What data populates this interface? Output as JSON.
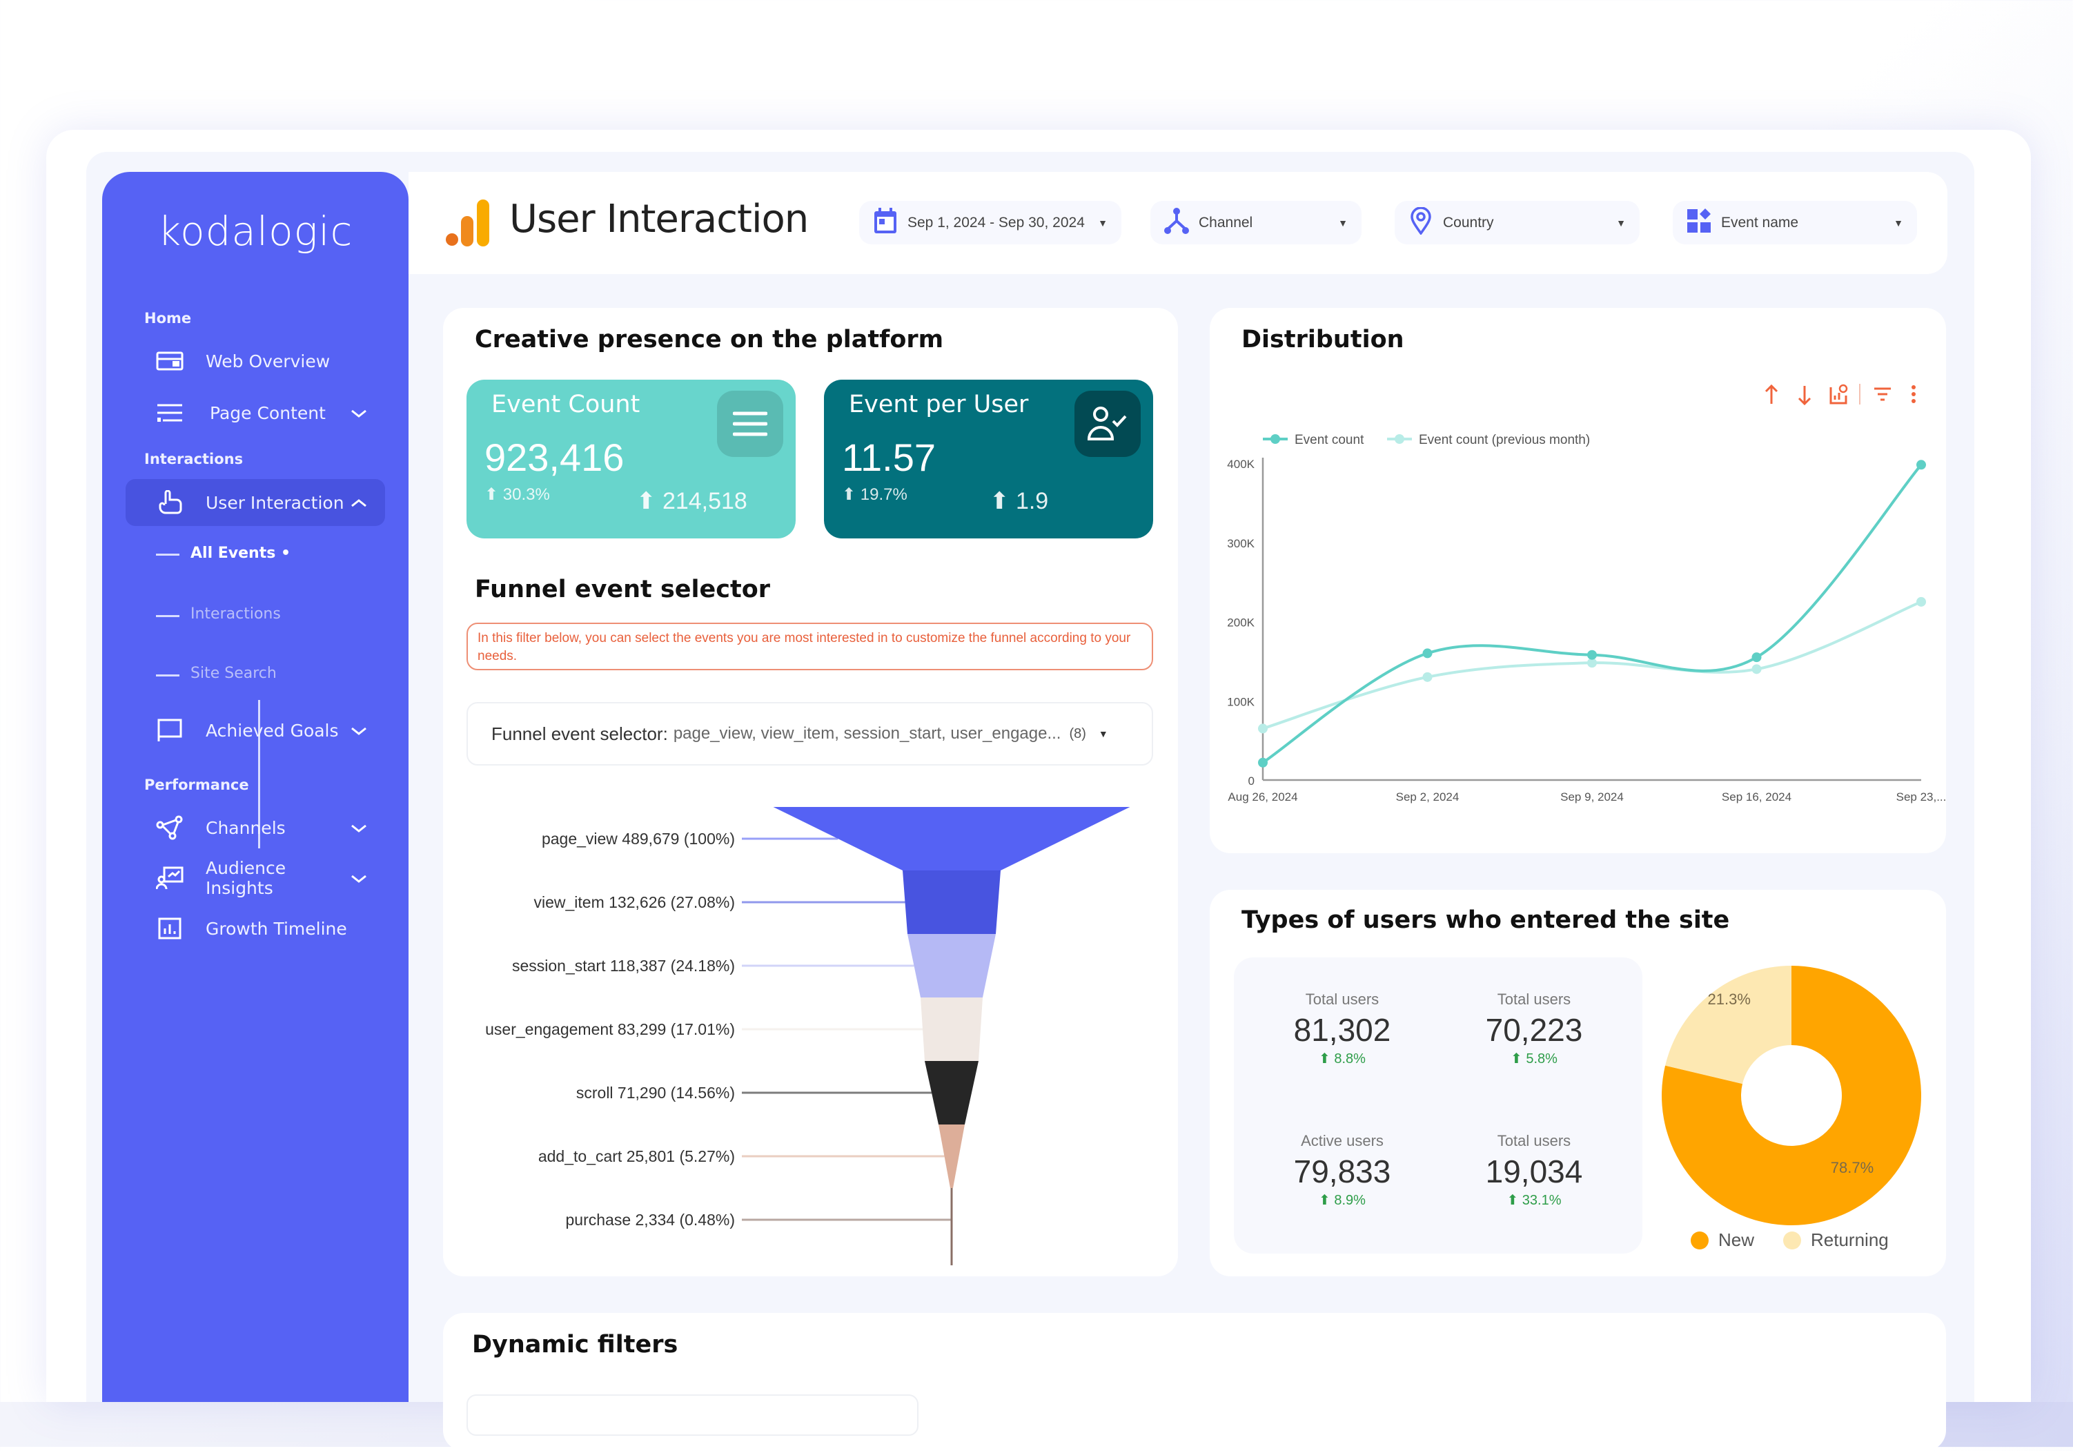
{
  "brand": "kodalogic",
  "sidebar": {
    "sections": [
      "Home",
      "Interactions",
      "Performance"
    ],
    "items": [
      {
        "label": "Web Overview",
        "icon": "browser-window-icon"
      },
      {
        "label": "Page Content",
        "icon": "list-icon",
        "chevron": "down"
      },
      {
        "label": "User Interaction",
        "icon": "pointer-hand-icon",
        "chevron": "up",
        "active": true
      },
      {
        "label": "Achieved Goals",
        "icon": "flag-icon",
        "chevron": "down"
      },
      {
        "label": "Channels",
        "icon": "share-nodes-icon",
        "chevron": "down"
      },
      {
        "label": "Audience Insights",
        "icon": "presentation-user-icon",
        "chevron": "down"
      },
      {
        "label": "Growth Timeline",
        "icon": "bar-chart-icon"
      }
    ],
    "subitems": [
      {
        "label": "All Events •",
        "current": true
      },
      {
        "label": "Interactions"
      },
      {
        "label": "Site Search"
      }
    ]
  },
  "header": {
    "title": "User Interaction",
    "filters": [
      {
        "label": "Sep 1, 2024 - Sep 30, 2024",
        "icon": "calendar-icon"
      },
      {
        "label": "Channel",
        "icon": "fork-icon"
      },
      {
        "label": "Country",
        "icon": "map-pin-icon"
      },
      {
        "label": "Event name",
        "icon": "grid-icon"
      }
    ]
  },
  "creative": {
    "title": "Creative presence on the platform",
    "kpis": [
      {
        "label": "Event Count",
        "value": "923,416",
        "change_pct": "30.3%",
        "change_abs": "214,518",
        "color": "#68D5CC",
        "icon": "menu-lines-icon"
      },
      {
        "label": "Event per User",
        "value": "11.57",
        "change_pct": "19.7%",
        "change_abs": "1.9",
        "color": "#03717D",
        "icon": "user-check-icon"
      }
    ],
    "funnel_title": "Funnel event selector",
    "info_text": "In this filter below, you can select the events you are most interested in to customize the funnel according to your needs.",
    "selector": {
      "label": "Funnel event selector:",
      "value": "page_view, view_item, session_start, user_engage...",
      "count": "(8)"
    },
    "funnel": [
      {
        "event": "page_view",
        "count": "489,679",
        "pct": "100%",
        "color": "#5562F4"
      },
      {
        "event": "view_item",
        "count": "132,626",
        "pct": "27.08%",
        "color": "#4854E0"
      },
      {
        "event": "session_start",
        "count": "118,387",
        "pct": "24.18%",
        "color": "#B5B9F5"
      },
      {
        "event": "user_engagement",
        "count": "83,299",
        "pct": "17.01%",
        "color": "#F0E8E3"
      },
      {
        "event": "scroll",
        "count": "71,290",
        "pct": "14.56%",
        "color": "#262626"
      },
      {
        "event": "add_to_cart",
        "count": "25,801",
        "pct": "5.27%",
        "color": "#DDAE99"
      },
      {
        "event": "purchase",
        "count": "2,334",
        "pct": "0.48%",
        "color": "#8A6F66"
      }
    ]
  },
  "chart_data": {
    "type": "line",
    "title": "Distribution",
    "x": [
      "Aug 26, 2024",
      "Sep 2, 2024",
      "Sep 9, 2024",
      "Sep 16, 2024",
      "Sep 23,..."
    ],
    "series": [
      {
        "name": "Event count",
        "values": [
          22000,
          160000,
          158000,
          155000,
          398000
        ],
        "color": "#5ECFC5"
      },
      {
        "name": "Event count (previous month)",
        "values": [
          65000,
          130000,
          148000,
          140000,
          225000
        ],
        "color": "#B8ECE7"
      }
    ],
    "yticks": [
      "0",
      "100K",
      "200K",
      "300K",
      "400K"
    ],
    "ylim": [
      0,
      400000
    ],
    "legend": "top-left",
    "grid": false,
    "toolbar_icons": [
      "arrow-up-icon",
      "arrow-down-icon",
      "chart-settings-icon",
      "filter-icon",
      "more-vertical-icon"
    ],
    "toolbar_color": "#F0643C"
  },
  "users": {
    "title": "Types of users who entered the site",
    "stats": [
      {
        "label": "Total users",
        "value": "81,302",
        "change": "8.8%"
      },
      {
        "label": "Total users",
        "value": "70,223",
        "change": "5.8%"
      },
      {
        "label": "Active users",
        "value": "79,833",
        "change": "8.9%"
      },
      {
        "label": "Total users",
        "value": "19,034",
        "change": "33.1%"
      }
    ],
    "donut": [
      {
        "name": "New",
        "pct": 78.7,
        "label": "78.7%",
        "color": "#FFA500"
      },
      {
        "name": "Returning",
        "pct": 21.3,
        "label": "21.3%",
        "color": "#FDE8B2"
      }
    ]
  },
  "dynamic": {
    "title": "Dynamic filters"
  }
}
